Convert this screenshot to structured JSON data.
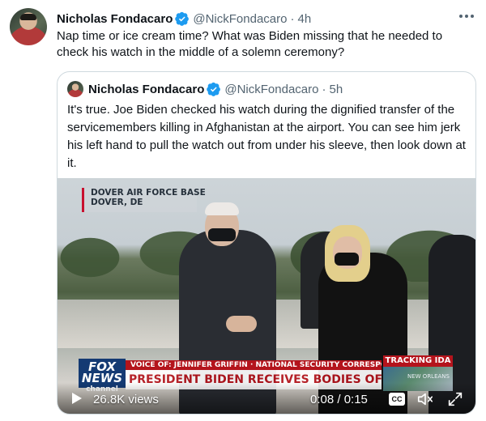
{
  "tweet": {
    "author_name": "Nicholas Fondacaro",
    "handle": "@NickFondacaro",
    "separator": "·",
    "time": "4h",
    "text": "Nap time or ice cream time? What was Biden missing that he needed to check his watch in the middle of a solemn ceremony?"
  },
  "quoted_tweet": {
    "author_name": "Nicholas Fondacaro",
    "handle": "@NickFondacaro",
    "separator": "·",
    "time": "5h",
    "text": "It's true. Joe Biden checked his watch during the dignified transfer of the servicemembers killing in Afghanistan at the airport. You can see him jerk his left hand to pull the watch out from under his sleeve, then look down at it."
  },
  "video": {
    "location_line1": "DOVER AIR FORCE BASE",
    "location_line2": "DOVER, DE",
    "network_logo_line1": "FOX",
    "network_logo_line2": "NEWS",
    "network_logo_line3": "channel",
    "chyron_top": "VOICE OF: JENNIFER GRIFFIN · NATIONAL SECURITY CORRESPONDENT",
    "chyron_main": "PRESIDENT BIDEN RECEIVES BODIES OF FALLEN TROOPS",
    "tracking_label": "TRACKING IDA",
    "tracking_map_label": "NEW ORLEANS",
    "views": "26.8K views",
    "timecode": "0:08 / 0:15",
    "cc_label": "CC"
  },
  "icons": {
    "verified": "verified-badge-icon",
    "more": "more-options-icon",
    "play": "play-icon",
    "cc": "closed-captions-icon",
    "mute": "mute-icon",
    "fullscreen": "fullscreen-icon"
  },
  "colors": {
    "accent": "#1d9bf0",
    "text_primary": "#0f1419",
    "text_secondary": "#536471",
    "border": "#cfd9de",
    "fox_red": "#b4141c",
    "fox_blue": "#143a73"
  }
}
